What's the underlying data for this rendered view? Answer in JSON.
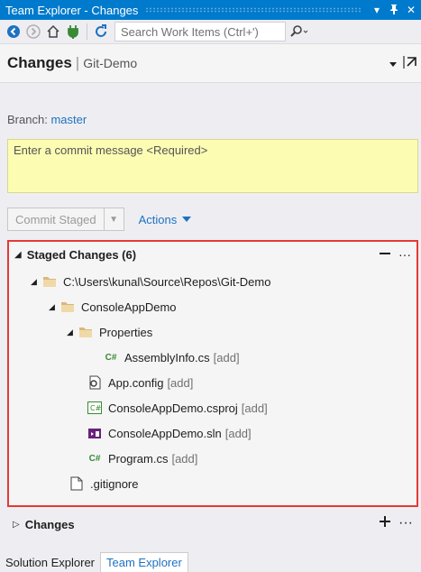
{
  "window": {
    "title": "Team Explorer - Changes",
    "dropdown_glyph": "▾",
    "pin_glyph": "ꟼ",
    "close_glyph": "✕"
  },
  "toolbar": {
    "search_placeholder": "Search Work Items (Ctrl+')"
  },
  "header": {
    "page": "Changes",
    "separator": "|",
    "repo": "Git-Demo"
  },
  "branch": {
    "label": "Branch:",
    "name": "master"
  },
  "commit": {
    "placeholder": "Enter a commit message <Required>"
  },
  "actions": {
    "commit_staged_label": "Commit Staged",
    "actions_label": "Actions"
  },
  "staged": {
    "title": "Staged Changes (6)",
    "items": [
      {
        "name": "C:\\Users\\kunal\\Source\\Repos\\Git-Demo",
        "tag": "",
        "icon": "folder-icon",
        "expanded": true
      },
      {
        "name": "ConsoleAppDemo",
        "tag": "",
        "icon": "folder-icon",
        "expanded": true
      },
      {
        "name": "Properties",
        "tag": "",
        "icon": "folder-icon",
        "expanded": true
      },
      {
        "name": "AssemblyInfo.cs",
        "tag": "[add]",
        "icon": "csharp-file-icon"
      },
      {
        "name": "App.config",
        "tag": "[add]",
        "icon": "config-file-icon"
      },
      {
        "name": "ConsoleAppDemo.csproj",
        "tag": "[add]",
        "icon": "csproj-file-icon"
      },
      {
        "name": "ConsoleAppDemo.sln",
        "tag": "[add]",
        "icon": "solution-file-icon"
      },
      {
        "name": "Program.cs",
        "tag": "[add]",
        "icon": "csharp-file-icon"
      },
      {
        "name": ".gitignore",
        "tag": "",
        "icon": "file-icon"
      }
    ]
  },
  "changes": {
    "title": "Changes"
  },
  "tabs": [
    {
      "label": "Solution Explorer"
    },
    {
      "label": "Team Explorer"
    }
  ],
  "colors": {
    "accent": "#007acc",
    "link": "#1e71c2",
    "highlight_border": "#e53935",
    "commit_bg": "#fcfcb3"
  }
}
